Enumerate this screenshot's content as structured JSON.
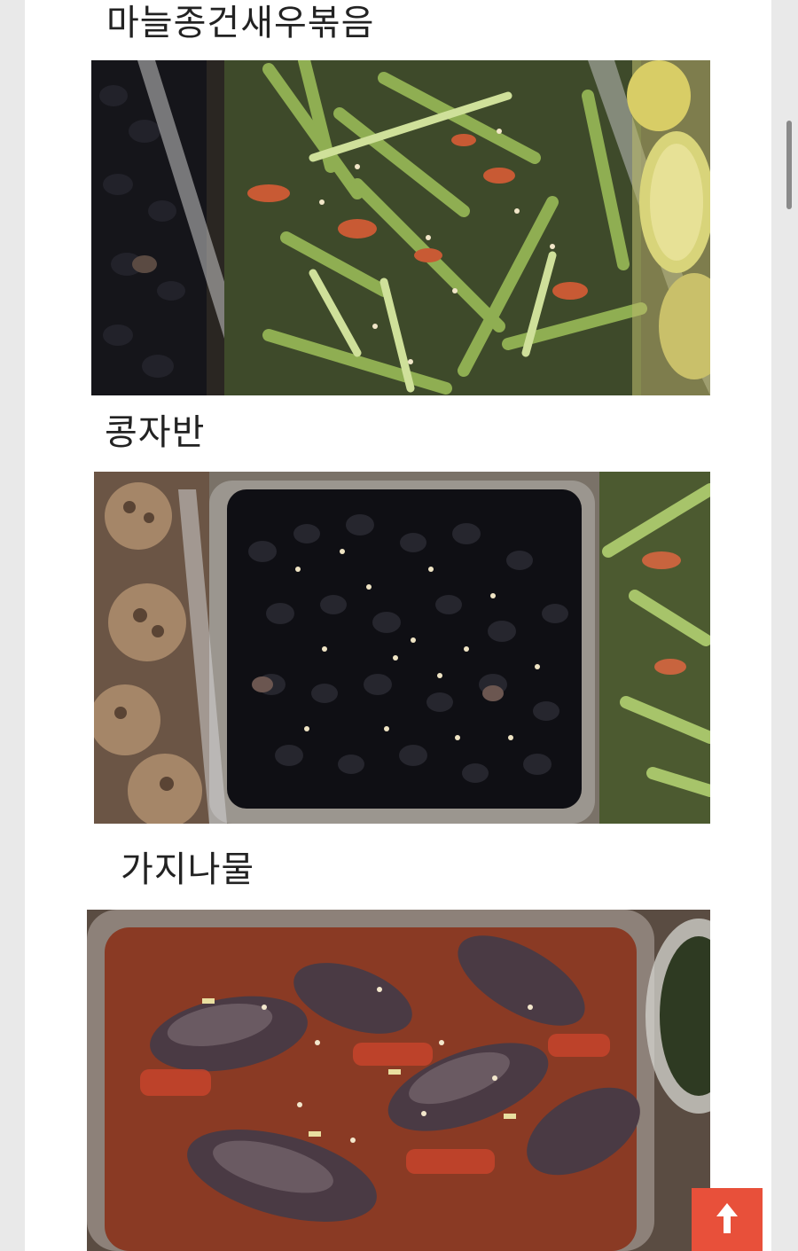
{
  "dishes": [
    {
      "title": "마늘종건새우볶음",
      "photo_icon": "garlic-scape-shrimp-photo"
    },
    {
      "title": "콩자반",
      "photo_icon": "braised-black-beans-photo"
    },
    {
      "title": "가지나물",
      "photo_icon": "eggplant-namul-photo"
    }
  ],
  "controls": {
    "scroll_top_icon": "arrow-up-icon",
    "accent_color": "#e8503a"
  }
}
